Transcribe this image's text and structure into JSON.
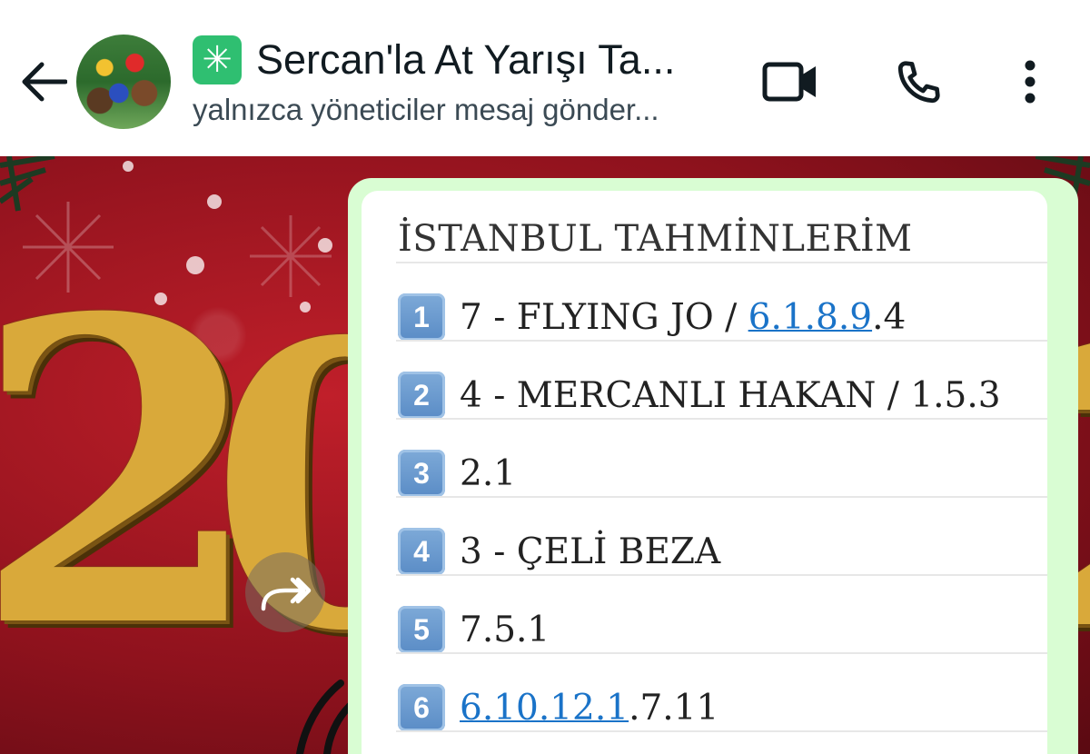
{
  "header": {
    "title": "Sercan'la At Yarışı Ta...",
    "subtitle": "yalnızca yöneticiler mesaj gönder...",
    "title_badge_glyph": "✳",
    "icons": [
      "back-arrow-icon",
      "video-call-icon",
      "phone-icon",
      "more-options-icon"
    ]
  },
  "message": {
    "title": "İSTANBUL TAHMİNLERİM",
    "rows": [
      {
        "num": "1",
        "text": "7 - FLYING JO / ",
        "link": "6.1.8.9",
        "after": ".4"
      },
      {
        "num": "2",
        "text": "4 - MERCANLI HAKAN / 1.5.3",
        "link": "",
        "after": ""
      },
      {
        "num": "3",
        "text": "2.1",
        "link": "",
        "after": ""
      },
      {
        "num": "4",
        "text": "3 - ÇELİ BEZA",
        "link": "",
        "after": ""
      },
      {
        "num": "5",
        "text": "7.5.1",
        "link": "",
        "after": ""
      },
      {
        "num": "6",
        "text": "",
        "link": "6.10.12.1",
        "after": ".7.11"
      }
    ]
  },
  "colors": {
    "bubble_outline": "#d9fdd3",
    "link": "#1a73c8",
    "badge": "#2fbf71",
    "keycap": "#5a8cc6"
  }
}
